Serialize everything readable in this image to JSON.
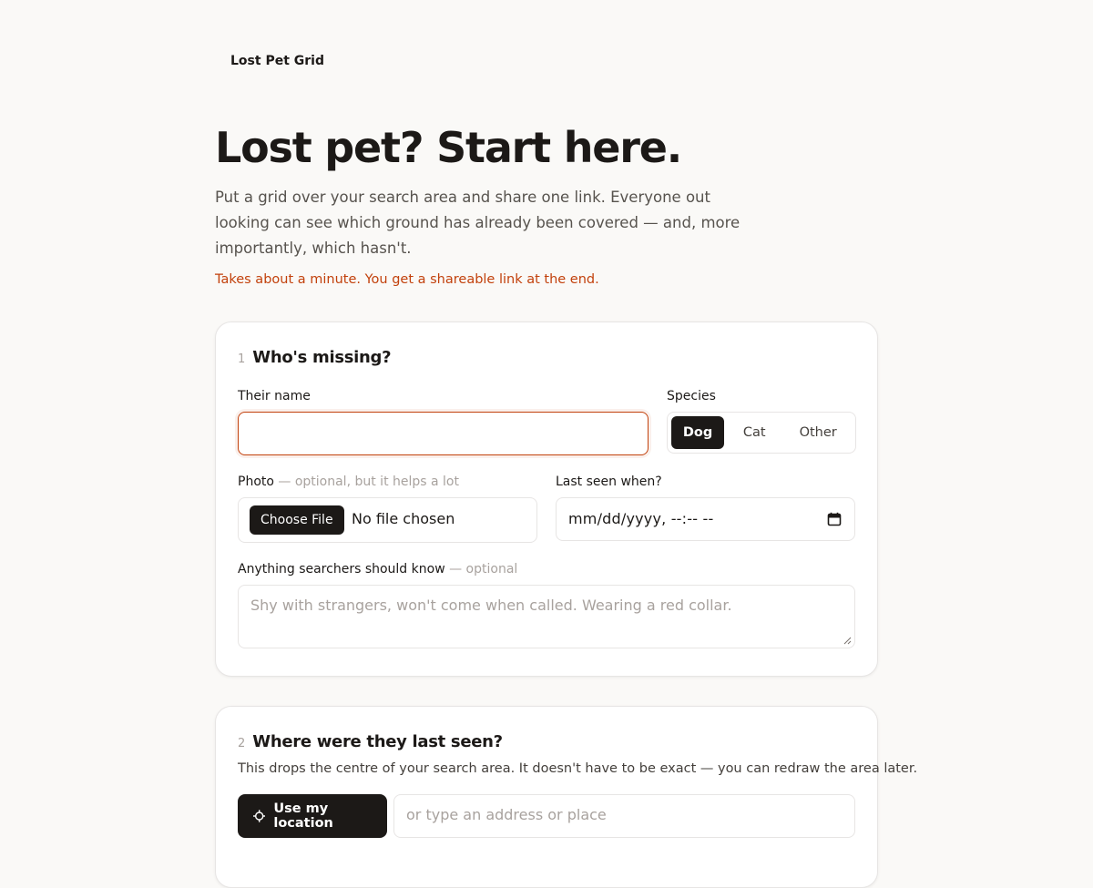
{
  "brand": {
    "name": "Lost Pet Grid"
  },
  "hero": {
    "title": "Lost pet? Start here.",
    "subtitle": "Put a grid over your search area and share one link. Everyone out looking can see which ground has already been covered — and, more importantly, which hasn't.",
    "note": "Takes about a minute. You get a shareable link at the end."
  },
  "step1": {
    "number": "1",
    "title": "Who's missing?",
    "name_field": {
      "label": "Their name",
      "value": "",
      "placeholder": ""
    },
    "species": {
      "label": "Species",
      "options": [
        "Dog",
        "Cat",
        "Other"
      ],
      "selected": "Dog"
    },
    "photo": {
      "label": "Photo",
      "hint": " — optional, but it helps a lot",
      "button_label": "Choose File",
      "status": "No file chosen"
    },
    "last_seen_when": {
      "label": "Last seen when?",
      "value": "mm/dd/yyyy, --:-- --"
    },
    "notes": {
      "label": "Anything searchers should know",
      "hint": " — optional",
      "placeholder": "Shy with strangers, won't come when called. Wearing a red collar.",
      "value": ""
    }
  },
  "step2": {
    "number": "2",
    "title": "Where were they last seen?",
    "description": "This drops the centre of your search area. It doesn't have to be exact — you can redraw the area later.",
    "location_button_label": "Use my location",
    "location_icon": "crosshair-icon",
    "address_placeholder": "or type an address or place"
  },
  "colors": {
    "accent": "#c2410c",
    "ink": "#1c1917",
    "background": "#faf9f7",
    "border": "#e7e5e4"
  }
}
